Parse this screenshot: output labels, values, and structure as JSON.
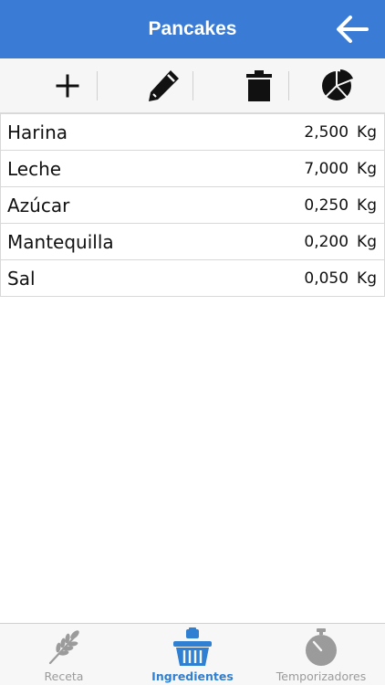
{
  "header": {
    "title": "Pancakes",
    "back_icon": "arrow-left-icon",
    "color": "#3a7bd5"
  },
  "toolbar": {
    "items": [
      {
        "icon": "plus-icon"
      },
      {
        "icon": "pencil-icon"
      },
      {
        "icon": "trash-icon"
      },
      {
        "icon": "pie-chart-icon"
      }
    ]
  },
  "ingredients": [
    {
      "name": "Harina",
      "amount": "2,500",
      "unit": "Kg"
    },
    {
      "name": "Leche",
      "amount": "7,000",
      "unit": "Kg"
    },
    {
      "name": "Azúcar",
      "amount": "0,250",
      "unit": "Kg"
    },
    {
      "name": "Mantequilla",
      "amount": "0,200",
      "unit": "Kg"
    },
    {
      "name": "Sal",
      "amount": "0,050",
      "unit": "Kg"
    }
  ],
  "tabbar": {
    "tabs": [
      {
        "label": "Receta",
        "icon": "wheat-icon",
        "active": false
      },
      {
        "label": "Ingredientes",
        "icon": "basket-icon",
        "active": true
      },
      {
        "label": "Temporizadores",
        "icon": "stopwatch-icon",
        "active": false
      }
    ],
    "active_color": "#2f7fd3",
    "inactive_color": "#9b9b9b"
  }
}
